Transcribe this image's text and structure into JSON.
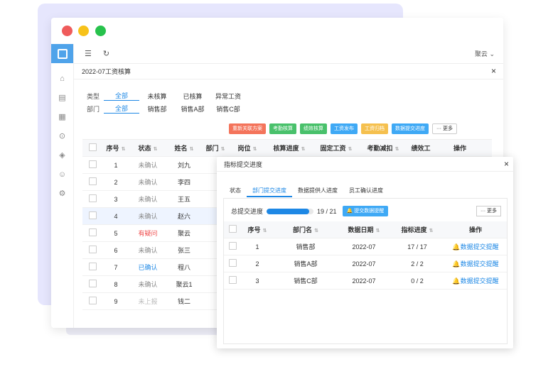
{
  "top": {
    "user": "聚云"
  },
  "breadcrumb": {
    "title": "2022-07工资核算"
  },
  "filters": {
    "type": {
      "label": "类型",
      "options": [
        "全部",
        "未核算",
        "已核算",
        "异常工资"
      ],
      "active": 0
    },
    "dept": {
      "label": "部门",
      "options": [
        "全部",
        "销售部",
        "销售A部",
        "销售C部"
      ],
      "active": 0
    }
  },
  "toolbar": {
    "buttons": [
      {
        "label": "重新关联方案",
        "color": "#f4745b"
      },
      {
        "label": "考勤核算",
        "color": "#49c16b"
      },
      {
        "label": "绩效核算",
        "color": "#49c16b"
      },
      {
        "label": "工资发布",
        "color": "#3fa9f5"
      },
      {
        "label": "工资归档",
        "color": "#f5c04e"
      },
      {
        "label": "数据提交进度",
        "color": "#3fa9f5"
      }
    ],
    "more": "··· 更多"
  },
  "table1": {
    "headers": [
      "序号",
      "状态",
      "姓名",
      "部门",
      "岗位",
      "核算进度",
      "固定工资",
      "考勤减扣",
      "绩效工",
      "操作"
    ],
    "rows": [
      {
        "no": "1",
        "status": "未确认",
        "status_color": "#888888",
        "name": "刘九"
      },
      {
        "no": "2",
        "status": "未确认",
        "status_color": "#888888",
        "name": "李四"
      },
      {
        "no": "3",
        "status": "未确认",
        "status_color": "#888888",
        "name": "王五"
      },
      {
        "no": "4",
        "status": "未确认",
        "status_color": "#888888",
        "name": "赵六"
      },
      {
        "no": "5",
        "status": "有疑问",
        "status_color": "#ef4b4b",
        "name": "聚云"
      },
      {
        "no": "6",
        "status": "未确认",
        "status_color": "#888888",
        "name": "张三"
      },
      {
        "no": "7",
        "status": "已确认",
        "status_color": "#1e88e5",
        "name": "程八"
      },
      {
        "no": "8",
        "status": "未确认",
        "status_color": "#888888",
        "name": "聚云1"
      },
      {
        "no": "9",
        "status": "未上报",
        "status_color": "#bbbbbb",
        "name": "钱二"
      }
    ]
  },
  "dialog": {
    "title": "指标提交进度",
    "tabs": [
      "状态",
      "部门提交进度",
      "数据提供人进度",
      "员工确认进度"
    ],
    "active_tab": 1,
    "progress_label": "总提交进度",
    "progress_text": "19 / 21",
    "progress_value": 0.905,
    "remind_button": "提交数据提醒",
    "more": "··· 更多",
    "headers": [
      "序号",
      "部门名",
      "数据日期",
      "指标进度",
      "操作"
    ],
    "rows": [
      {
        "no": "1",
        "dept": "销售部",
        "date": "2022-07",
        "progress": "17 / 17",
        "action": "数据提交提醒"
      },
      {
        "no": "2",
        "dept": "销售A部",
        "date": "2022-07",
        "progress": "2 / 2",
        "action": "数据提交提醒"
      },
      {
        "no": "3",
        "dept": "销售C部",
        "date": "2022-07",
        "progress": "0 / 2",
        "action": "数据提交提醒"
      }
    ]
  }
}
